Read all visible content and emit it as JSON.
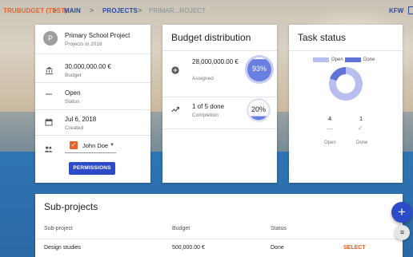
{
  "header": {
    "brand": "TRUBUDGET (TEST)",
    "breadcrumbs": [
      "MAIN",
      "PROJECTS",
      "PRIMAR...ROJECT"
    ],
    "separator": ">",
    "user": "KFW"
  },
  "project": {
    "avatar_letter": "P",
    "name": "Primary School Project",
    "subtitle": "Projects in 2018",
    "budget_value": "30,000,000.00 €",
    "budget_label": "Budget",
    "status_value": "Open",
    "status_label": "Status",
    "date_value": "Jul 6, 2018",
    "date_label": "Created",
    "owner": "John Doe",
    "permissions_button": "PERMISSIONS"
  },
  "budget": {
    "title": "Budget distribution",
    "assigned_value": "28,000,000.00 €",
    "assigned_label": "Assigned",
    "assigned_percent_text": "93%",
    "assigned_percent": 93,
    "completion_value": "1 of 5 done",
    "completion_label": "Completion",
    "completion_percent_text": "20%",
    "completion_percent": 20
  },
  "tasks": {
    "title": "Task status",
    "legend": [
      "Open",
      "Done"
    ],
    "open_count": "4",
    "done_count": "1",
    "open_label": "Open",
    "done_label": "Done",
    "chart_data": {
      "type": "pie",
      "categories": [
        "Open",
        "Done"
      ],
      "values": [
        4,
        1
      ]
    },
    "colors": {
      "open": "#b8bfee",
      "done": "#5f73d6"
    }
  },
  "subprojects": {
    "title": "Sub-projects",
    "columns": [
      "Sub-project",
      "Budget",
      "Status"
    ],
    "rows": [
      {
        "name": "Design studies",
        "budget": "500,000.00 €",
        "status": "Done",
        "action": "SELECT"
      }
    ]
  },
  "fab": {
    "add": "+",
    "menu": "≡"
  }
}
